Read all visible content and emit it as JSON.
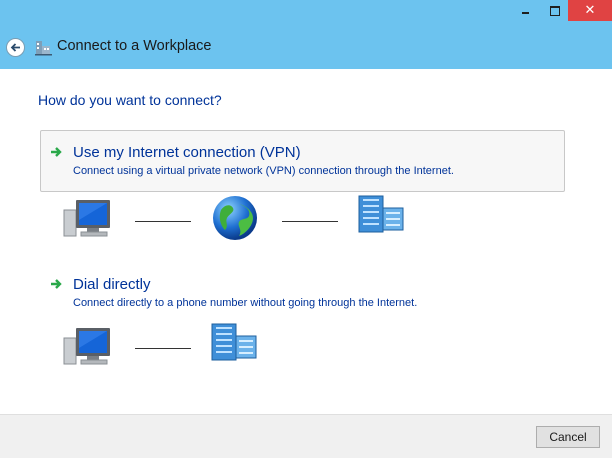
{
  "window": {
    "title": "Connect to a Workplace",
    "close_glyph": "✕"
  },
  "main": {
    "heading": "How do you want to connect?",
    "options": [
      {
        "title": "Use my Internet connection (VPN)",
        "description": "Connect using a virtual private network (VPN) connection through the Internet.",
        "icon": "green-arrow-icon",
        "selected": true
      },
      {
        "title": "Dial directly",
        "description": "Connect directly to a phone number without going through the Internet.",
        "icon": "green-arrow-icon",
        "selected": false
      }
    ],
    "diagram_icons": {
      "vpn": [
        "computer-icon",
        "globe-icon",
        "office-building-icon"
      ],
      "dial": [
        "computer-icon",
        "office-building-icon"
      ]
    }
  },
  "footer": {
    "cancel_label": "Cancel"
  },
  "colors": {
    "title_bar": "#6cc3ef",
    "link_blue": "#003399",
    "close_red": "#e04343"
  }
}
